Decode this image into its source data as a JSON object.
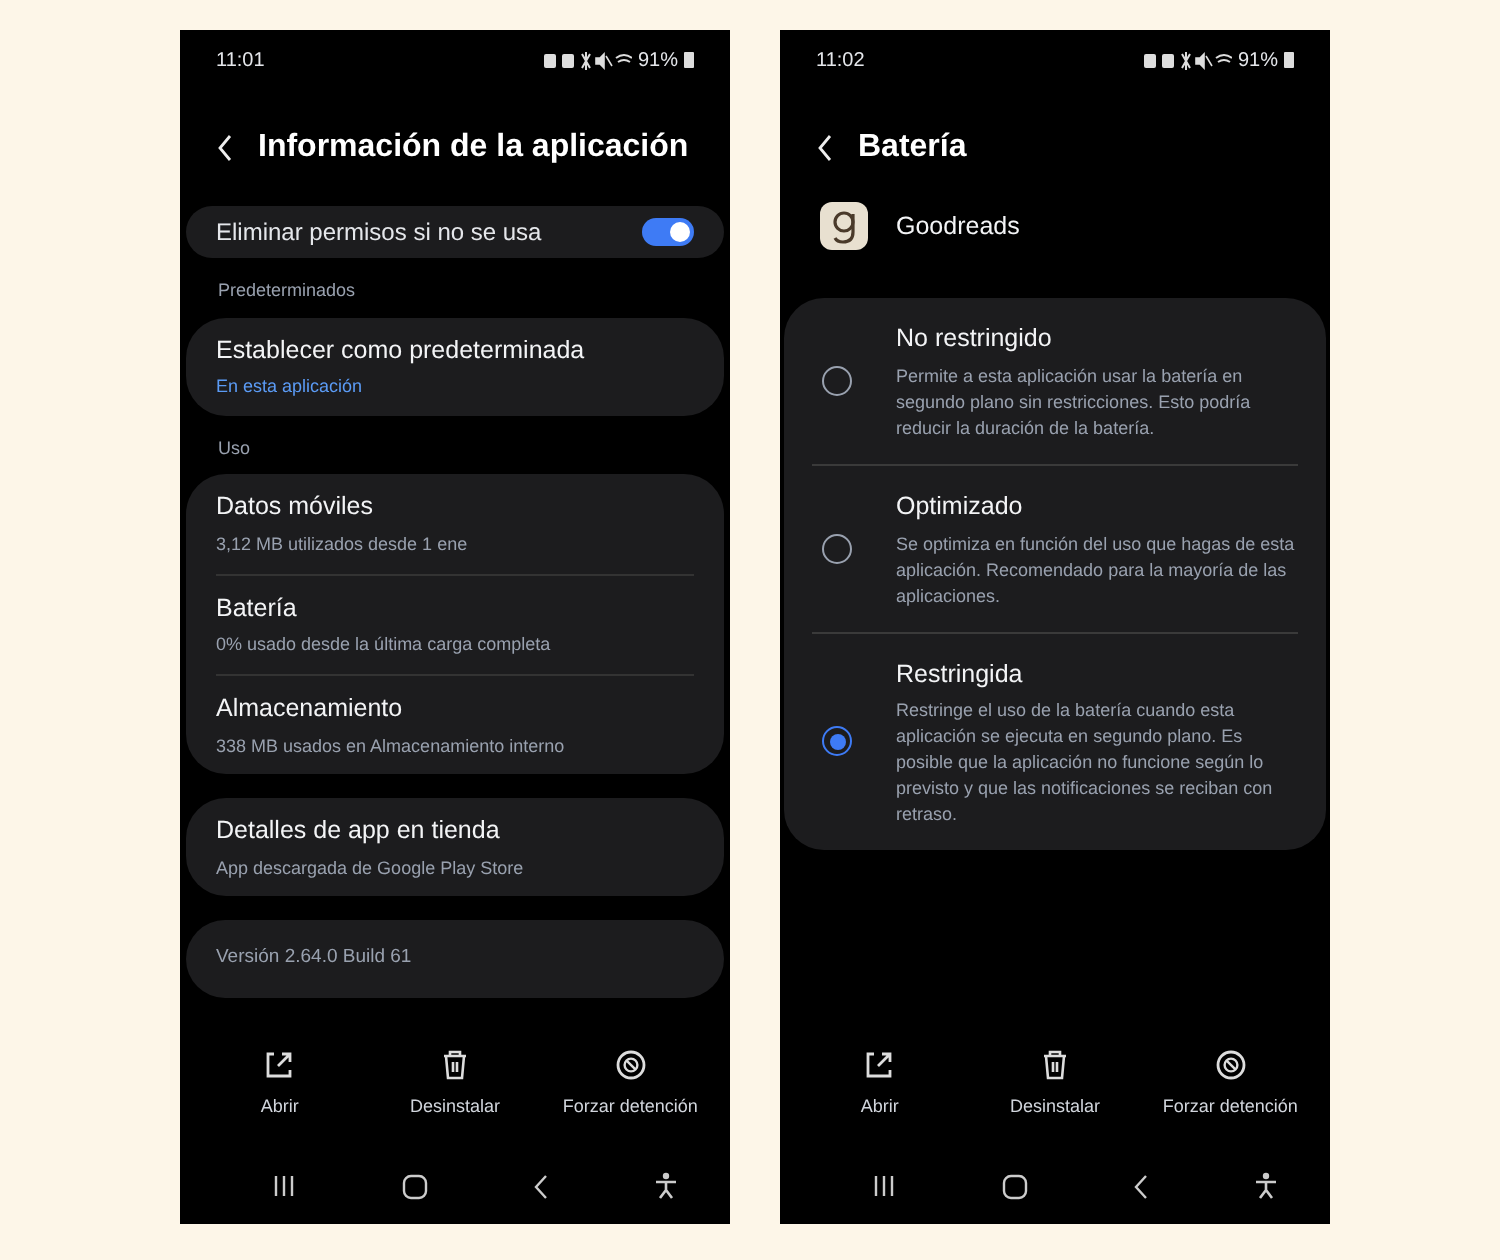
{
  "app_info_screen": {
    "status_bar": {
      "time": "11:01",
      "battery": "91%"
    },
    "title": "Información de la aplicación",
    "groups": [
      {
        "items": [
          {
            "kind": "toggle",
            "title": "Eliminar permisos si no se usa",
            "on": true
          }
        ]
      },
      {
        "heading": "Predeterminados",
        "items": [
          {
            "kind": "row",
            "title": "Establecer como predeterminada",
            "subtitle": "En esta aplicación",
            "accent": true
          }
        ]
      },
      {
        "heading": "Uso",
        "items": [
          {
            "kind": "row",
            "title": "Datos móviles",
            "subtitle": "3,12 MB utilizados desde 1 ene",
            "accent": false
          },
          {
            "kind": "row",
            "title": "Batería",
            "subtitle": "0% usado desde la última carga completa",
            "accent": false
          },
          {
            "kind": "row",
            "title": "Almacenamiento",
            "subtitle": "338 MB usados en Almacenamiento interno",
            "accent": false
          }
        ]
      },
      {
        "items": [
          {
            "kind": "row",
            "title": "Detalles de app en tienda",
            "subtitle": "App descargada de Google Play Store",
            "accent": false
          }
        ]
      },
      {
        "items": [
          {
            "kind": "note",
            "title": "Versión 2.64.0 Build 61"
          }
        ]
      }
    ],
    "actions": [
      "Abrir",
      "Desinstalar",
      "Forzar detención"
    ]
  },
  "battery_screen": {
    "status_bar": {
      "time": "11:02",
      "battery": "91%"
    },
    "title": "Batería",
    "app_name": "Goodreads",
    "options": [
      {
        "title": "No restringido",
        "description": "Permite a esta aplicación usar la batería en segundo plano sin restricciones. Esto podría reducir la duración de la batería.",
        "selected": false
      },
      {
        "title": "Optimizado",
        "description": "Se optimiza en función del uso que hagas de esta aplicación. Recomendado para la mayoría de las aplicaciones.",
        "selected": false
      },
      {
        "title": "Restringida",
        "description": "Restringe el uso de la batería cuando esta aplicación se ejecuta en segundo plano. Es posible que la aplicación no funcione según lo previsto y que las notificaciones se reciban con retraso.",
        "selected": true
      }
    ],
    "actions": [
      "Abrir",
      "Desinstalar",
      "Forzar detención"
    ]
  }
}
